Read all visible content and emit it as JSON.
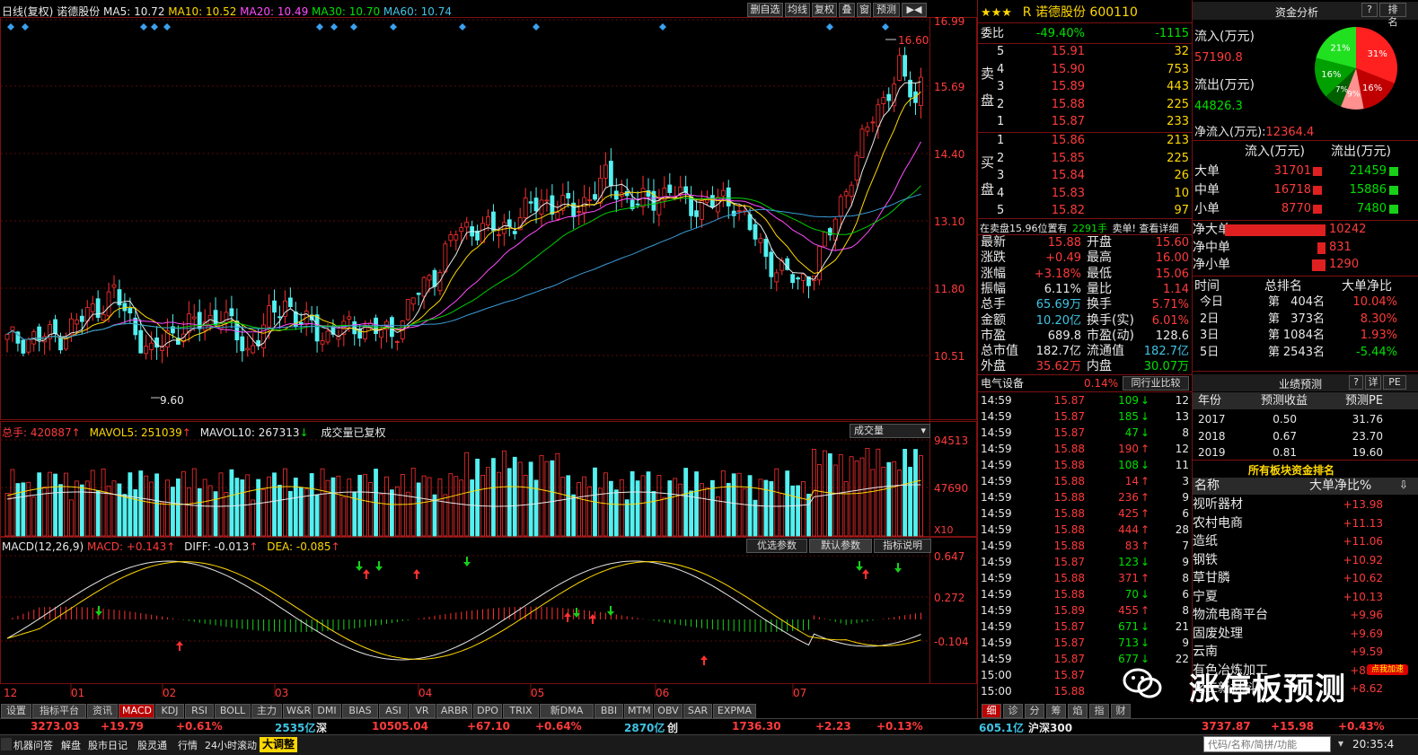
{
  "chart_header": {
    "title": "日线(复权)",
    "stock": "诺德股份",
    "ma5": "MA5: 10.72",
    "ma10": "MA10: 10.52",
    "ma20": "MA20: 10.49",
    "ma30": "MA30: 10.70",
    "ma60": "MA60: 10.74",
    "buttons": [
      "删自选",
      "均线",
      "复权",
      "叠",
      "窗",
      "预测"
    ]
  },
  "price_axis": [
    "16.99",
    "15.69",
    "14.40",
    "13.10",
    "11.80",
    "10.51"
  ],
  "price_marks": {
    "high": "16.60",
    "low": "9.60"
  },
  "volume_header": {
    "total": "总手: 420887",
    "mavol5": "MAVOL5: 251039",
    "mavol10": "MAVOL10: 267313",
    "note": "成交量已复权",
    "selector": "成交量"
  },
  "volume_axis": [
    "94513",
    "47690",
    "X10"
  ],
  "macd_header": {
    "title": "MACD(12,26,9)",
    "macd": "MACD: +0.143",
    "diff": "DIFF: -0.013",
    "dea": "DEA: -0.085",
    "buttons": [
      "优选参数",
      "默认参数",
      "指标说明"
    ]
  },
  "macd_axis": [
    "0.647",
    "0.272",
    "-0.104"
  ],
  "months": [
    "12",
    "01",
    "02",
    "03",
    "04",
    "05",
    "06",
    "07"
  ],
  "indicator_tabs": [
    "设置",
    "指标平台",
    "资讯",
    "MACD",
    "KDJ",
    "RSI",
    "BOLL",
    "主力",
    "W&R",
    "DMI",
    "BIAS",
    "ASI",
    "VR",
    "ARBR",
    "DPO",
    "TRIX",
    "新DMA",
    "BBI",
    "MTM",
    "OBV",
    "SAR",
    "EXPMA"
  ],
  "quote": {
    "stars": "★★★",
    "title": "R 诺德股份 600110",
    "weibi_label": "委比",
    "weibi": "-49.40%",
    "weicha": "-1115",
    "sell_label": [
      "卖",
      "盘"
    ],
    "buy_label": [
      "买",
      "盘"
    ],
    "sells": [
      {
        "lvl": "5",
        "price": "15.91",
        "vol": "32"
      },
      {
        "lvl": "4",
        "price": "15.90",
        "vol": "753"
      },
      {
        "lvl": "3",
        "price": "15.89",
        "vol": "443"
      },
      {
        "lvl": "2",
        "price": "15.88",
        "vol": "225"
      },
      {
        "lvl": "1",
        "price": "15.87",
        "vol": "233"
      }
    ],
    "buys": [
      {
        "lvl": "1",
        "price": "15.86",
        "vol": "213"
      },
      {
        "lvl": "2",
        "price": "15.85",
        "vol": "225"
      },
      {
        "lvl": "3",
        "price": "15.84",
        "vol": "26"
      },
      {
        "lvl": "4",
        "price": "15.83",
        "vol": "10"
      },
      {
        "lvl": "5",
        "price": "15.82",
        "vol": "97"
      }
    ],
    "notice": "在卖盘15.96位置有",
    "notice_vol": "2291手",
    "notice_tail": "卖单! 查看详细",
    "stats": [
      [
        "最新",
        "15.88",
        "开盘",
        "15.60"
      ],
      [
        "涨跌",
        "+0.49",
        "最高",
        "16.00"
      ],
      [
        "涨幅",
        "+3.18%",
        "最低",
        "15.06"
      ],
      [
        "振幅",
        "6.11%",
        "量比",
        "1.14"
      ],
      [
        "总手",
        "65.69万",
        "换手",
        "5.71%"
      ],
      [
        "金额",
        "10.20亿",
        "换手(实)",
        "6.01%"
      ],
      [
        "市盈",
        "689.8",
        "市盈(动)",
        "128.6"
      ],
      [
        "总市值",
        "182.7亿",
        "流通值",
        "182.7亿"
      ],
      [
        "外盘",
        "35.62万",
        "内盘",
        "30.07万"
      ]
    ],
    "sector": "电气设备",
    "sector_pct": "0.14%",
    "sector_btn": "同行业比较"
  },
  "ticks": [
    [
      "14:59",
      "15.87",
      "109",
      "12",
      "d"
    ],
    [
      "14:59",
      "15.87",
      "185",
      "13",
      "d"
    ],
    [
      "14:59",
      "15.87",
      "47",
      "8",
      "d"
    ],
    [
      "14:59",
      "15.88",
      "190",
      "12",
      "u"
    ],
    [
      "14:59",
      "15.88",
      "108",
      "11",
      "d"
    ],
    [
      "14:59",
      "15.88",
      "14",
      "3",
      "u"
    ],
    [
      "14:59",
      "15.88",
      "236",
      "9",
      "u"
    ],
    [
      "14:59",
      "15.88",
      "425",
      "6",
      "u"
    ],
    [
      "14:59",
      "15.88",
      "444",
      "28",
      "u"
    ],
    [
      "14:59",
      "15.88",
      "83",
      "7",
      "u"
    ],
    [
      "14:59",
      "15.87",
      "123",
      "9",
      "d"
    ],
    [
      "14:59",
      "15.88",
      "371",
      "8",
      "u"
    ],
    [
      "14:59",
      "15.88",
      "70",
      "6",
      "d"
    ],
    [
      "14:59",
      "15.89",
      "455",
      "8",
      "u"
    ],
    [
      "14:59",
      "15.87",
      "671",
      "21",
      "d"
    ],
    [
      "14:59",
      "15.87",
      "713",
      "9",
      "d"
    ],
    [
      "14:59",
      "15.87",
      "677",
      "22",
      "d"
    ],
    [
      "15:00",
      "15.87",
      "",
      "",
      ""
    ],
    [
      "15:00",
      "15.88",
      "",
      "",
      ""
    ]
  ],
  "tick_tabs": [
    "细",
    "诊",
    "分",
    "筹",
    "焰",
    "指",
    "财"
  ],
  "funds": {
    "title": "资金分析",
    "btn_q": "?",
    "btn_rank": "排名",
    "inflow_label": "流入(万元)",
    "inflow": "57190.8",
    "outflow_label": "流出(万元)",
    "outflow": "44826.3",
    "net_label": "净流入(万元):",
    "net": "12364.4",
    "pie": [
      {
        "label": "31%",
        "value": 31,
        "color": "#ff2020"
      },
      {
        "label": "16%",
        "value": 16,
        "color": "#c00000"
      },
      {
        "label": "9%",
        "value": 9,
        "color": "#ff9090"
      },
      {
        "label": "7%",
        "value": 7,
        "color": "#006000"
      },
      {
        "label": "16%",
        "value": 16,
        "color": "#00a000"
      },
      {
        "label": "21%",
        "value": 21,
        "color": "#20e020"
      }
    ],
    "cols": [
      "流入(万元)",
      "流出(万元)"
    ],
    "rows": [
      {
        "name": "大单",
        "in": "31701",
        "out": "21459"
      },
      {
        "name": "中单",
        "in": "16718",
        "out": "15886"
      },
      {
        "name": "小单",
        "in": "8770",
        "out": "7480"
      }
    ],
    "net_rows": [
      {
        "name": "净大单",
        "value": "10242",
        "frac": 1.0
      },
      {
        "name": "净中单",
        "value": "831",
        "frac": 0.08
      },
      {
        "name": "净小单",
        "value": "1290",
        "frac": 0.13
      }
    ],
    "rank_cols": [
      "时间",
      "总排名",
      "大单净比"
    ],
    "ranks": [
      [
        "今日",
        "第",
        "404",
        "名",
        "10.04%"
      ],
      [
        "2日",
        "第",
        "373",
        "名",
        "8.30%"
      ],
      [
        "3日",
        "第",
        "1084",
        "名",
        "1.93%"
      ],
      [
        "5日",
        "第",
        "2543",
        "名",
        "-5.44%"
      ]
    ]
  },
  "forecast": {
    "title": "业绩预测",
    "btn_q": "?",
    "btn_detail": "详",
    "btn_pe": "PE",
    "cols": [
      "年份",
      "预测收益",
      "预测PE"
    ],
    "rows": [
      [
        "2017",
        "0.50",
        "31.76"
      ],
      [
        "2018",
        "0.67",
        "23.70"
      ],
      [
        "2019",
        "0.81",
        "19.60"
      ]
    ]
  },
  "sector_rank": {
    "title": "所有板块资金排名",
    "cols": [
      "名称",
      "大单净比%"
    ],
    "rows": [
      [
        "视听器材",
        "+13.98"
      ],
      [
        "农村电商",
        "+11.13"
      ],
      [
        "造纸",
        "+11.06"
      ],
      [
        "钢铁",
        "+10.92"
      ],
      [
        "草甘膦",
        "+10.62"
      ],
      [
        "宁夏",
        "+10.13"
      ],
      [
        "物流电商平台",
        "+9.96"
      ],
      [
        "固废处理",
        "+9.69"
      ],
      [
        "云南",
        "+9.59"
      ],
      [
        "有色冶炼加工",
        "+8.80"
      ],
      [
        "化工新材料",
        "+8.62"
      ]
    ]
  },
  "watermark": "涨停板预测",
  "badge": "点我加速",
  "badge_num": "87",
  "status": {
    "sh_idx": "3273.03",
    "sh_chg": "+19.79",
    "sh_pct": "+0.61%",
    "sh_amt": "2535亿",
    "sz_label": "深",
    "sz_idx": "10505.04",
    "sz_chg": "+67.10",
    "sz_pct": "+0.64%",
    "sz_amt": "2870亿",
    "cy_label": "创",
    "cy_idx": "1736.30",
    "cy_chg": "+2.23",
    "cy_pct": "+0.13%",
    "cy_amt": "605.1亿",
    "hs_label": "沪深300",
    "hs_idx": "3737.87",
    "hs_chg": "+15.98",
    "hs_pct": "+0.43%"
  },
  "bottom_bar": {
    "items": [
      "机器问答",
      "解盘",
      "股市日记",
      "股灵通",
      "行情",
      "24小时滚动"
    ],
    "news": "大调整",
    "search_placeholder": "代码/名称/简拼/功能",
    "clock": "20:35:4"
  }
}
